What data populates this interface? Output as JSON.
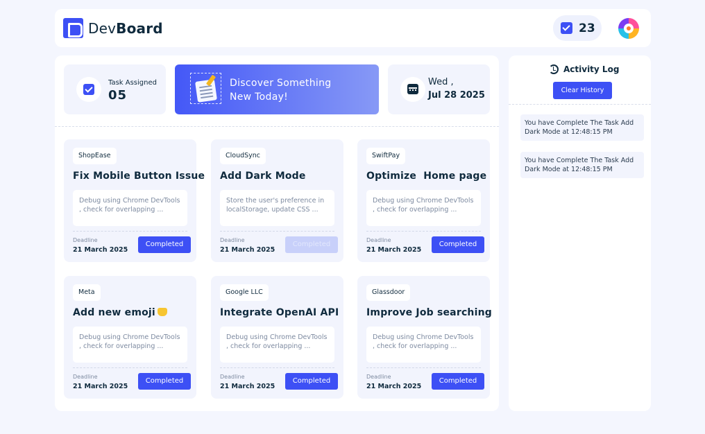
{
  "header": {
    "logo_light": "Dev",
    "logo_bold": "Board",
    "task_count": "23",
    "icons": {
      "logo": "devboard-logo-icon",
      "tasks": "checkbox-icon",
      "avatar": "user-avatar"
    }
  },
  "stats": {
    "task_label": "Task Assigned",
    "task_value": "05",
    "banner_line1": "Discover Something",
    "banner_line2": "New Today!",
    "day": "Wed ,",
    "date": "Jul 28 2025"
  },
  "cards": [
    {
      "company": "ShopEase",
      "title": "Fix Mobile Button Issue",
      "desc": "Debug using Chrome DevTools , check for overlapping ...",
      "deadline_label": "Deadline",
      "deadline": "21 March 2025",
      "button": "Completed",
      "enabled": true
    },
    {
      "company": "CloudSync",
      "title": "Add Dark Mode",
      "desc": "Store the user's preference in localStorage, update CSS ...",
      "deadline_label": "Deadline",
      "deadline": "21 March 2025",
      "button": "Completed",
      "enabled": false
    },
    {
      "company": "SwiftPay",
      "title": "Optimize  Home page",
      "desc": "Debug using Chrome DevTools , check for overlapping ...",
      "deadline_label": "Deadline",
      "deadline": "21 March 2025",
      "button": "Completed",
      "enabled": true
    },
    {
      "company": "Meta",
      "title": "Add new emoji",
      "desc": "Debug using Chrome DevTools , check for overlapping ...",
      "deadline_label": "Deadline",
      "deadline": "21 March 2025",
      "button": "Completed",
      "enabled": true
    },
    {
      "company": "Google LLC",
      "title": "Integrate OpenAI API",
      "desc": "Debug using Chrome DevTools , check for overlapping ...",
      "deadline_label": "Deadline",
      "deadline": "21 March 2025",
      "button": "Completed",
      "enabled": true
    },
    {
      "company": "Glassdoor",
      "title": "Improve Job searching",
      "desc": "Debug using Chrome DevTools , check for overlapping ...",
      "deadline_label": "Deadline",
      "deadline": "21 March 2025",
      "button": "Completed",
      "enabled": true
    }
  ],
  "activity": {
    "title": "Activity Log",
    "clear_label": "Clear History",
    "logs": [
      "You have Complete The Task Add Dark Mode at 12:48:15 PM",
      "You have Complete The Task Add Dark Mode at 12:48:15 PM"
    ]
  },
  "colors": {
    "accent": "#3d50f5",
    "background": "#f4f6fe",
    "card": "#f2f4fd",
    "text": "#0f2a3d"
  }
}
